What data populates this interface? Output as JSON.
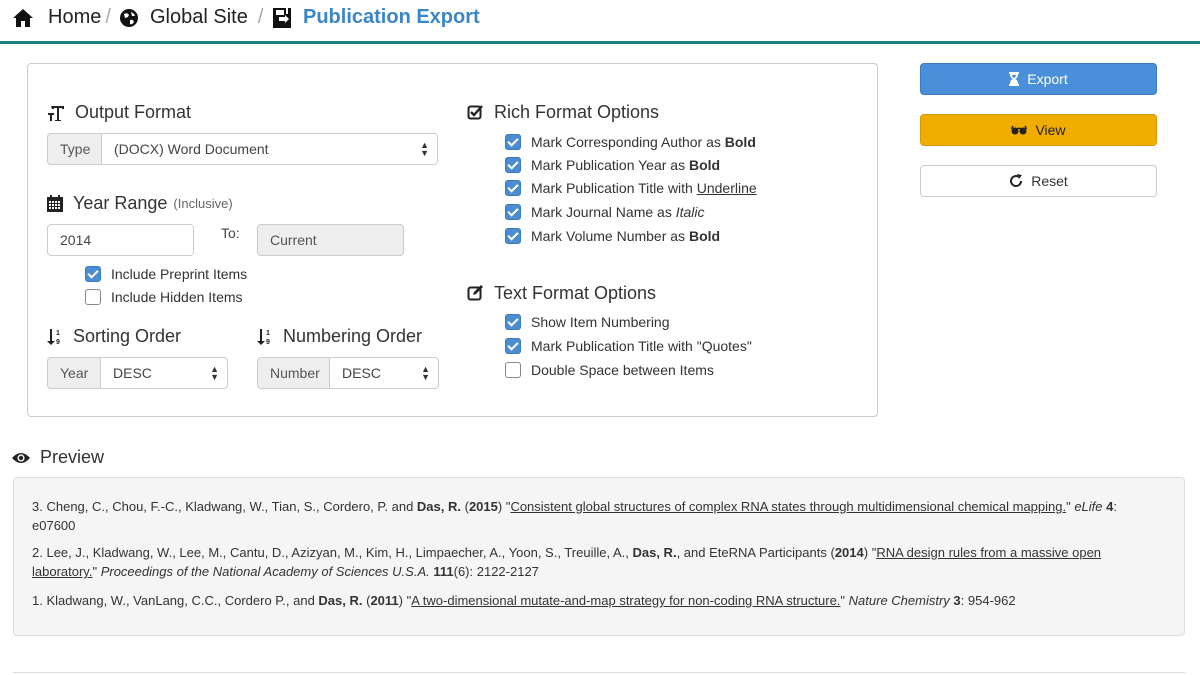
{
  "breadcrumb": {
    "home": "Home",
    "site": "Global Site",
    "current": "Publication Export",
    "separator": "/"
  },
  "output_format": {
    "title": "Output Format",
    "type_label": "Type",
    "type_value": "(DOCX) Word Document"
  },
  "year_range": {
    "title": "Year Range",
    "subtitle": "(Inclusive)",
    "from_value": "2014",
    "to_label": "To:",
    "to_value": "Current",
    "include_preprint": {
      "label": "Include Preprint Items",
      "checked": true
    },
    "include_hidden": {
      "label": "Include Hidden Items",
      "checked": false
    }
  },
  "sorting": {
    "title": "Sorting Order",
    "addon": "Year",
    "value": "DESC"
  },
  "numbering": {
    "title": "Numbering Order",
    "addon": "Number",
    "value": "DESC"
  },
  "rich_format": {
    "title": "Rich Format Options",
    "items": [
      {
        "prefix": "Mark Corresponding Author as ",
        "styled": "Bold",
        "style": "bold",
        "checked": true
      },
      {
        "prefix": "Mark Publication Year as ",
        "styled": "Bold",
        "style": "bold",
        "checked": true
      },
      {
        "prefix": "Mark Publication Title with ",
        "styled": "Underline",
        "style": "underline",
        "checked": true
      },
      {
        "prefix": "Mark Journal Name as ",
        "styled": "Italic",
        "style": "italic",
        "checked": true
      },
      {
        "prefix": "Mark Volume Number as ",
        "styled": "Bold",
        "style": "bold",
        "checked": true
      }
    ]
  },
  "text_format": {
    "title": "Text Format Options",
    "items": [
      {
        "label": "Show Item Numbering",
        "checked": true
      },
      {
        "label": "Mark Publication Title with \"Quotes\"",
        "checked": true
      },
      {
        "label": "Double Space between Items",
        "checked": false
      }
    ]
  },
  "buttons": {
    "export": "Export",
    "view": "View",
    "reset": "Reset"
  },
  "preview": {
    "title": "Preview",
    "entries": [
      {
        "num": "3.",
        "authors": "Cheng, C., Chou, F.-C., Kladwang, W., Tian, S., Cordero, P. and ",
        "bold_author": "Das, R.",
        "after_author": "",
        "year": "2015",
        "title": "Consistent global structures of complex RNA states through multidimensional chemical mapping.",
        "journal": "eLife",
        "volume": "4",
        "issue": "",
        "pages": ": e07600"
      },
      {
        "num": "2.",
        "authors": "Lee, J., Kladwang, W., Lee, M., Cantu, D., Azizyan, M., Kim, H., Limpaecher, A., Yoon, S., Treuille, A., ",
        "bold_author": "Das, R.",
        "after_author": ", and EteRNA Participants",
        "year": "2014",
        "title": "RNA design rules from a massive open laboratory.",
        "journal": "Proceedings of the National Academy of Sciences U.S.A.",
        "volume": "111",
        "issue": "(6)",
        "pages": ": 2122-2127"
      },
      {
        "num": "1.",
        "authors": "Kladwang, W., VanLang, C.C., Cordero P., and ",
        "bold_author": "Das, R.",
        "after_author": "",
        "year": "2011",
        "title": "A two-dimensional mutate-and-map strategy for non-coding RNA structure.",
        "journal": "Nature Chemistry",
        "volume": "3",
        "issue": "",
        "pages": ": 954-962"
      }
    ]
  },
  "colors": {
    "accent_bar": "#1d7f86",
    "breadcrumb_active": "#3b86c8",
    "export_button": "#4a8fd9",
    "view_button": "#f0ad00",
    "checkbox_on": "#4a8ed1"
  }
}
